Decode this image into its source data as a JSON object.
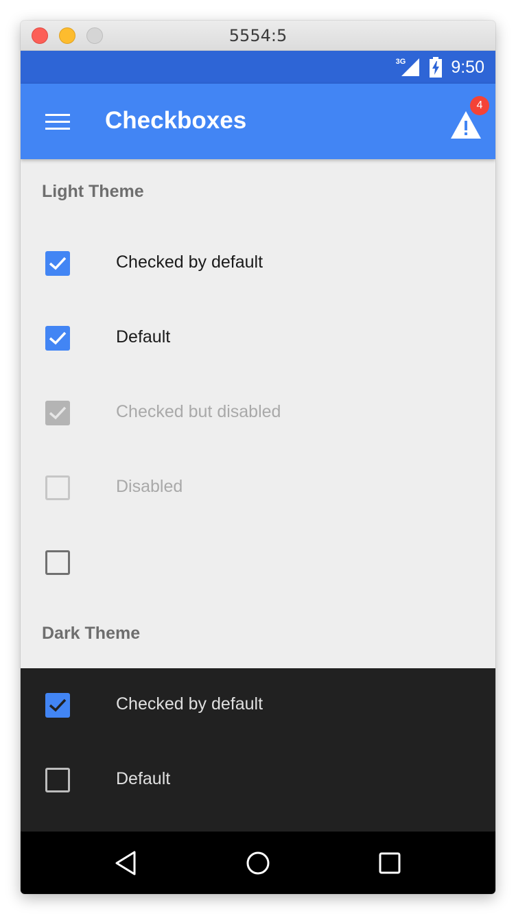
{
  "window": {
    "title": "5554:5"
  },
  "status_bar": {
    "network": "3G",
    "time": "9:50"
  },
  "app_bar": {
    "title": "Checkboxes",
    "alert_badge": "4",
    "accent": "#4285f4"
  },
  "light_theme": {
    "heading": "Light Theme",
    "items": [
      {
        "label": "Checked by default",
        "state": "checked"
      },
      {
        "label": "Default",
        "state": "checked"
      },
      {
        "label": "Checked but disabled",
        "state": "checked-disabled"
      },
      {
        "label": "Disabled",
        "state": "unchecked-disabled"
      },
      {
        "label": "",
        "state": "unchecked"
      }
    ]
  },
  "dark_theme": {
    "heading": "Dark Theme",
    "items": [
      {
        "label": "Checked by default",
        "state": "checked"
      },
      {
        "label": "Default",
        "state": "unchecked"
      }
    ]
  },
  "nav_bar": {
    "icons": [
      "back-icon",
      "home-icon",
      "recents-icon"
    ]
  }
}
